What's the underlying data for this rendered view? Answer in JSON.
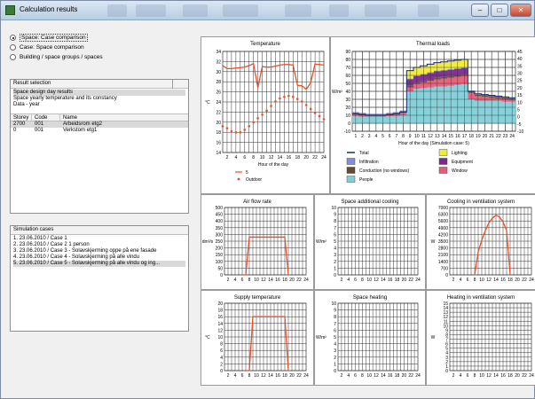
{
  "window": {
    "title": "Calculation results"
  },
  "mode": {
    "options": [
      {
        "label": "Space: Case comparison",
        "selected": true
      },
      {
        "label": "Case: Space comparison",
        "selected": false
      },
      {
        "label": "Building / space groups / spaces",
        "selected": false
      }
    ]
  },
  "result_selection": {
    "header": "Result selection",
    "items": [
      {
        "label": "Space design day results",
        "selected": true
      },
      {
        "label": "Space yearly temperature and its constancy",
        "selected": false
      },
      {
        "label": "Data - year",
        "selected": false
      }
    ],
    "columns": [
      "Storey",
      "Code",
      "Name"
    ],
    "rows": [
      {
        "storey": "2700",
        "code": "001",
        "name": "Arbeidsrom etg2",
        "selected": true
      },
      {
        "storey": "0",
        "code": "001",
        "name": "Verkstom etg1",
        "selected": false
      }
    ]
  },
  "simulation_cases": {
    "header": "Simulation cases",
    "items": [
      {
        "label": "1. 23.06.2010 / Case 1",
        "selected": false
      },
      {
        "label": "2. 23.06.2010 / Case 2 1 person",
        "selected": false
      },
      {
        "label": "3. 23.06.2010 / Case 3 - Solavskjerming oppe på ene fasade",
        "selected": false
      },
      {
        "label": "4. 23.06.2010 / Case 4 - Solavskjerming på alle vindu",
        "selected": false
      },
      {
        "label": "5. 23.06.2010 / Case 5 - Solavskjerming på alle vindu og ing...",
        "selected": true
      }
    ]
  },
  "chart_data": [
    {
      "id": "temperature",
      "type": "line",
      "title": "Temperature",
      "ylabel": "°C",
      "xlabel": "Hour of the day",
      "ylim": [
        14,
        34
      ],
      "yticks": [
        14,
        16,
        18,
        20,
        22,
        24,
        26,
        28,
        30,
        32,
        34
      ],
      "xticks": [
        2,
        4,
        6,
        8,
        10,
        12,
        14,
        16,
        18,
        20,
        22,
        24
      ],
      "x": [
        1,
        2,
        3,
        4,
        5,
        6,
        7,
        8,
        9,
        10,
        11,
        12,
        13,
        14,
        15,
        16,
        17,
        18,
        19,
        20,
        21,
        22,
        23,
        24
      ],
      "series": [
        {
          "name": "5",
          "color": "#e8502a",
          "style": "line",
          "values": [
            31.2,
            30.6,
            30.6,
            30.7,
            30.8,
            30.9,
            31.2,
            31.6,
            26.8,
            31.0,
            30.9,
            30.9,
            31.1,
            31.3,
            31.4,
            31.4,
            31.3,
            27.3,
            27.2,
            26.5,
            27.8,
            31.5,
            31.4,
            31.3
          ]
        },
        {
          "name": "Outdoor",
          "color": "#e8502a",
          "style": "dots",
          "values": [
            19.2,
            18.8,
            18.2,
            18.0,
            18.0,
            18.5,
            19.2,
            20.0,
            20.8,
            21.5,
            22.3,
            23.2,
            24.1,
            24.7,
            25.0,
            25.2,
            25.0,
            24.6,
            24.1,
            23.4,
            22.6,
            21.8,
            21.2,
            20.6
          ]
        }
      ],
      "legend": "bottom"
    },
    {
      "id": "thermal_loads",
      "type": "area",
      "title": "Thermal loads",
      "ylabel": "W/m²",
      "xlabel": "Hour of the day (Simulation case: 5)",
      "ylim": [
        -10,
        90
      ],
      "yticks": [
        -10,
        0,
        10,
        20,
        30,
        40,
        50,
        60,
        70,
        80,
        90
      ],
      "right_yticks": [
        -10,
        -5,
        0,
        5,
        10,
        15,
        20,
        25,
        30,
        35,
        40,
        45
      ],
      "xticks": [
        1,
        2,
        3,
        4,
        5,
        6,
        7,
        8,
        9,
        10,
        11,
        12,
        13,
        14,
        15,
        16,
        17,
        18,
        19,
        20,
        21,
        22,
        23,
        24
      ],
      "x": [
        1,
        2,
        3,
        4,
        5,
        6,
        7,
        8,
        9,
        10,
        11,
        12,
        13,
        14,
        15,
        16,
        17,
        18,
        19,
        20,
        21,
        22,
        23,
        24
      ],
      "series": [
        {
          "name": "Total",
          "color": "#1c2a6b",
          "style": "line",
          "values": [
            12,
            11,
            10,
            10,
            10,
            11,
            12,
            14,
            66,
            70,
            72,
            74,
            76,
            77,
            78,
            79,
            80,
            40,
            37,
            36,
            35,
            34,
            33,
            32
          ]
        },
        {
          "name": "Lighting",
          "color": "#f0ea3a",
          "style": "band",
          "values": [
            0,
            0,
            0,
            0,
            0,
            0,
            0,
            0,
            10,
            10,
            10,
            10,
            10,
            10,
            10,
            10,
            10,
            0,
            0,
            0,
            0,
            0,
            0,
            0
          ]
        },
        {
          "name": "Infiltration",
          "color": "#7f8fd8",
          "style": "band",
          "values": [
            1,
            1,
            1,
            1,
            1,
            1,
            1,
            1,
            1,
            1,
            1,
            1,
            1,
            1,
            1,
            1,
            1,
            1,
            1,
            1,
            1,
            1,
            1,
            1
          ]
        },
        {
          "name": "Equipment",
          "color": "#7a2a8c",
          "style": "band",
          "values": [
            0,
            0,
            0,
            0,
            0,
            0,
            0,
            0,
            8,
            8,
            8,
            8,
            8,
            8,
            8,
            8,
            8,
            0,
            0,
            0,
            0,
            0,
            0,
            0
          ]
        },
        {
          "name": "Conduction (no windows)",
          "color": "#6a4a2e",
          "style": "band",
          "values": [
            2,
            2,
            2,
            2,
            2,
            2,
            2,
            2,
            2,
            2,
            2,
            2,
            2,
            2,
            2,
            2,
            2,
            2,
            2,
            2,
            2,
            2,
            2,
            2
          ]
        },
        {
          "name": "Window",
          "color": "#e85a78",
          "style": "band",
          "values": [
            2,
            2,
            1,
            1,
            1,
            1,
            2,
            3,
            5,
            6,
            7,
            8,
            9,
            10,
            10,
            10,
            10,
            8,
            6,
            5,
            4,
            3,
            3,
            2
          ]
        },
        {
          "name": "People",
          "color": "#7fcfd8",
          "style": "band",
          "values": [
            9,
            8,
            8,
            8,
            8,
            9,
            9,
            10,
            40,
            43,
            44,
            45,
            46,
            46,
            47,
            48,
            49,
            30,
            28,
            28,
            28,
            28,
            27,
            27
          ]
        }
      ],
      "legend": "bottom"
    },
    {
      "id": "air_flow",
      "type": "line",
      "title": "Air flow rate",
      "ylabel": "dm³/s",
      "ylim": [
        0,
        500
      ],
      "yticks": [
        0,
        50,
        100,
        150,
        200,
        250,
        300,
        350,
        400,
        450,
        500
      ],
      "xticks": [
        2,
        4,
        6,
        8,
        10,
        12,
        14,
        16,
        18,
        20,
        22,
        24
      ],
      "x": [
        6,
        7,
        8,
        9,
        17,
        18,
        19
      ],
      "series": [
        {
          "name": "5",
          "color": "#e8502a",
          "style": "line",
          "values": [
            0,
            0,
            280,
            280,
            280,
            280,
            0
          ]
        }
      ]
    },
    {
      "id": "space_cooling",
      "type": "line",
      "title": "Space additional cooling",
      "ylabel": "W/m²",
      "ylim": [
        0,
        10
      ],
      "yticks": [
        0,
        1,
        2,
        3,
        4,
        5,
        6,
        7,
        8,
        9,
        10
      ],
      "xticks": [
        2,
        4,
        6,
        8,
        10,
        12,
        14,
        16,
        18,
        20,
        22,
        24
      ],
      "x": [],
      "series": []
    },
    {
      "id": "vent_cooling",
      "type": "line",
      "title": "Cooling in ventilation system",
      "ylabel": "W",
      "ylim": [
        0,
        7000
      ],
      "yticks": [
        0,
        700,
        1400,
        2100,
        2800,
        3500,
        4200,
        4900,
        5600,
        6300,
        7000
      ],
      "xticks": [
        2,
        4,
        6,
        8,
        10,
        12,
        14,
        16,
        18,
        20,
        22,
        24
      ],
      "x": [
        8,
        9,
        10,
        11,
        12,
        13,
        14,
        15,
        16,
        17,
        18
      ],
      "series": [
        {
          "name": "5",
          "color": "#e8502a",
          "style": "line",
          "values": [
            0,
            2400,
            3600,
            4600,
            5400,
            5900,
            6200,
            6000,
            5500,
            4600,
            0
          ]
        }
      ]
    },
    {
      "id": "supply_temp",
      "type": "line",
      "title": "Supply temperature",
      "ylabel": "°C",
      "ylim": [
        0,
        20
      ],
      "yticks": [
        0,
        2,
        4,
        6,
        8,
        10,
        12,
        14,
        16,
        18,
        20
      ],
      "xticks": [
        2,
        4,
        6,
        8,
        10,
        12,
        14,
        16,
        18,
        20,
        22,
        24
      ],
      "x": [
        7,
        8,
        9,
        17,
        18,
        19
      ],
      "series": [
        {
          "name": "5",
          "color": "#e8502a",
          "style": "line",
          "values": [
            0,
            0,
            16,
            16,
            16,
            0
          ]
        }
      ]
    },
    {
      "id": "space_heating",
      "type": "line",
      "title": "Space heating",
      "ylabel": "W/m²",
      "ylim": [
        0,
        10
      ],
      "yticks": [
        0,
        1,
        2,
        3,
        4,
        5,
        6,
        7,
        8,
        9,
        10
      ],
      "xticks": [
        2,
        4,
        6,
        8,
        10,
        12,
        14,
        16,
        18,
        20,
        22,
        24
      ],
      "x": [],
      "series": []
    },
    {
      "id": "vent_heating",
      "type": "line",
      "title": "Heating in ventilation system",
      "ylabel": "W",
      "ylim": [
        0,
        15
      ],
      "yticks": [
        0,
        1,
        2,
        3,
        4,
        5,
        6,
        7,
        8,
        9,
        10,
        11,
        12,
        13,
        14,
        15
      ],
      "xticks": [
        2,
        4,
        6,
        8,
        10,
        12,
        14,
        16,
        18,
        20,
        22,
        24
      ],
      "x": [],
      "series": []
    }
  ]
}
